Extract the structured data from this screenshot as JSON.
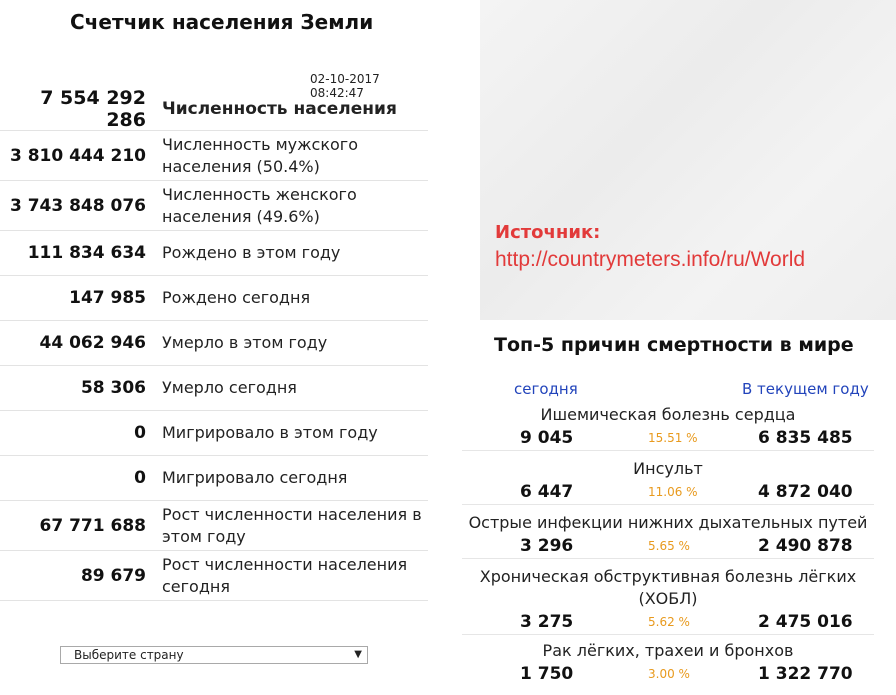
{
  "header": {
    "title": "Счетчик населения Земли",
    "timestamp": "02-10-2017 08:42:47"
  },
  "stats": [
    {
      "value": "7 554 292 286",
      "label": "Численность населения"
    },
    {
      "value": "3 810 444 210",
      "label": "Численность мужского населения (50.4%)"
    },
    {
      "value": "3 743 848 076",
      "label": "Численность женского населения (49.6%)"
    },
    {
      "value": "111 834 634",
      "label": "Рождено в этом году"
    },
    {
      "value": "147 985",
      "label": "Рождено сегодня"
    },
    {
      "value": "44 062 946",
      "label": "Умерло в этом году"
    },
    {
      "value": "58 306",
      "label": "Умерло сегодня"
    },
    {
      "value": "0",
      "label": "Мигрировало в этом году"
    },
    {
      "value": "0",
      "label": "Мигрировало сегодня"
    },
    {
      "value": "67 771 688",
      "label": "Рост численности населения в этом году"
    },
    {
      "value": "89 679",
      "label": "Рост численности населения сегодня"
    }
  ],
  "country_select": {
    "value": "Выберите страну"
  },
  "source": {
    "label": "Источник:",
    "url": "http://countrymeters.info/ru/World"
  },
  "causes": {
    "title": "Топ-5 причин смертности в мире",
    "col_today": "сегодня",
    "col_year": "В текущем году",
    "items": [
      {
        "name": "Ишемическая болезнь сердца",
        "today": "9 045",
        "percent": "15.51 %",
        "year": "6 835 485"
      },
      {
        "name": "Инсульт",
        "today": "6 447",
        "percent": "11.06 %",
        "year": "4 872 040"
      },
      {
        "name": "Острые инфекции нижних дыхательных путей",
        "today": "3 296",
        "percent": "5.65 %",
        "year": "2 490 878"
      },
      {
        "name": "Хроническая обструктивная болезнь лёгких (ХОБЛ)",
        "today": "3 275",
        "percent": "5.62 %",
        "year": "2 475 016"
      },
      {
        "name": "Рак лёгких, трахеи и бронхов",
        "today": "1 750",
        "percent": "3.00 %",
        "year": "1 322 770"
      }
    ]
  },
  "colors": {
    "source": "#e23a3a",
    "column_header": "#2244bb",
    "percent": "#e89a1e"
  }
}
